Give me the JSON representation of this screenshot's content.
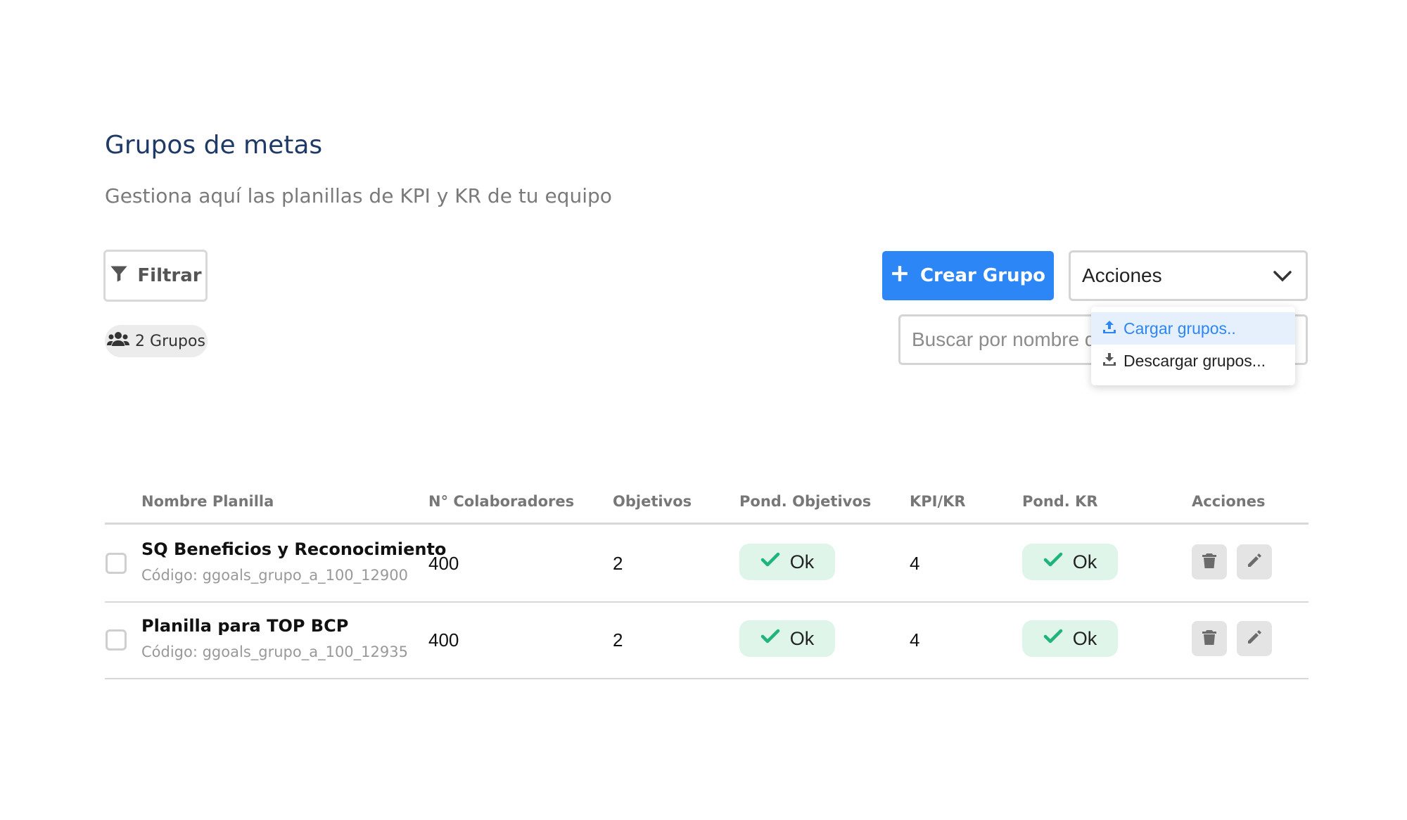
{
  "header": {
    "title": "Grupos de metas",
    "subtitle": "Gestiona aquí las planillas de KPI y KR de tu equipo"
  },
  "toolbar": {
    "filter_label": "Filtrar",
    "group_count": "2 Grupos",
    "create_label": "Crear Grupo",
    "actions_label": "Acciones",
    "search_placeholder": "Buscar por nombre d"
  },
  "actions_menu": {
    "items": [
      {
        "label": "Cargar grupos..",
        "icon": "upload-icon",
        "highlighted": true
      },
      {
        "label": "Descargar grupos...",
        "icon": "download-icon",
        "highlighted": false
      }
    ]
  },
  "table": {
    "columns": [
      "Nombre Planilla",
      "N° Colaboradores",
      "Objetivos",
      "Pond. Objetivos",
      "KPI/KR",
      "Pond. KR",
      "Acciones"
    ],
    "rows": [
      {
        "name": "SQ Beneficios y Reconocimiento",
        "code": "Código:  ggoals_grupo_a_100_12900",
        "colaboradores": "400",
        "objetivos": "2",
        "pond_objetivos": "Ok",
        "kpi_kr": "4",
        "pond_kr": "Ok"
      },
      {
        "name": "Planilla para TOP BCP",
        "code": "Código:  ggoals_grupo_a_100_12935",
        "colaboradores": "400",
        "objetivos": "2",
        "pond_objetivos": "Ok",
        "kpi_kr": "4",
        "pond_kr": "Ok"
      }
    ]
  },
  "colors": {
    "primary": "#2c86f5",
    "title": "#1f3a66",
    "ok_bg": "#dff5ea",
    "ok_check": "#1fb57a",
    "menu_highlight": "#e6f0fd"
  }
}
